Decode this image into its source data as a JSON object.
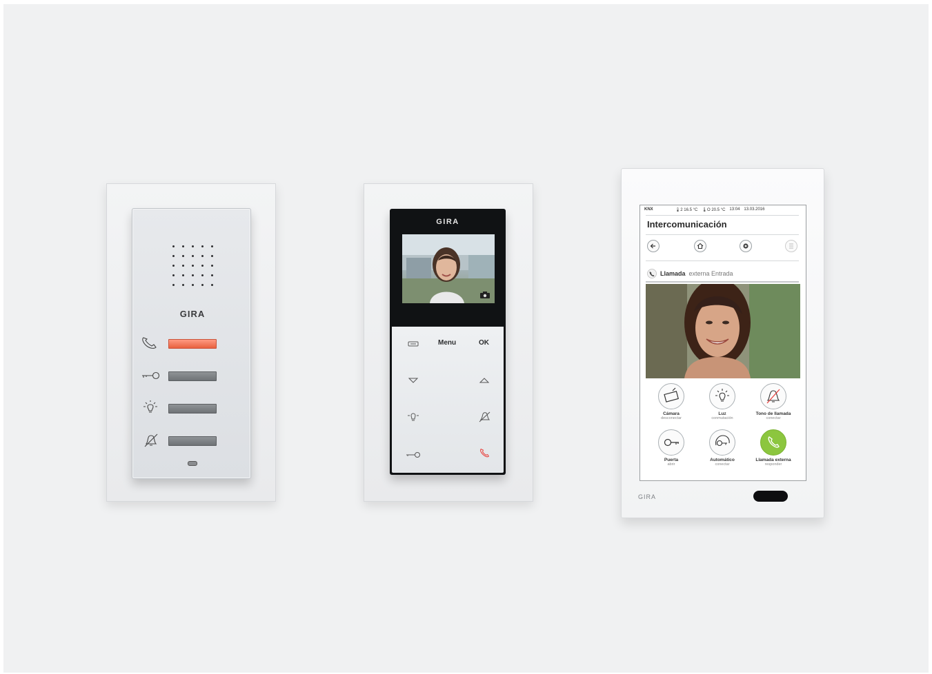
{
  "devices": {
    "audio_station": {
      "brand": "GIRA",
      "rows": [
        {
          "icon": "handset-icon",
          "state": "lit"
        },
        {
          "icon": "key-icon",
          "state": "off"
        },
        {
          "icon": "light-icon",
          "state": "off"
        },
        {
          "icon": "bell-mute-icon",
          "state": "off"
        }
      ]
    },
    "video_station": {
      "brand": "GIRA",
      "keys": {
        "menu": "Menu",
        "ok": "OK"
      },
      "colors": {
        "hangup": "#e8403c"
      }
    },
    "touch_panel": {
      "brand": "GIRA",
      "status": {
        "system": "KNX",
        "temp1": "🌡2 16.5 °C",
        "temp2": "🌡O 20.5 °C",
        "time": "13:04",
        "date": "13.03.2016"
      },
      "title": "Intercomunicación",
      "call": {
        "bold": "Llamada",
        "rest": "externa Entrada"
      },
      "buttons": [
        {
          "label": "Cámara",
          "sub": "desconectar",
          "icon": "camera-icon"
        },
        {
          "label": "Luz",
          "sub": "conmutación",
          "icon": "light-icon"
        },
        {
          "label": "Tono de llamada",
          "sub": "conectar",
          "icon": "bell-mute-icon"
        },
        {
          "label": "Puerta",
          "sub": "abrir",
          "icon": "key-icon"
        },
        {
          "label": "Automático",
          "sub": "conectar",
          "icon": "auto-door-icon"
        },
        {
          "label": "Llamada externa",
          "sub": "responder",
          "icon": "handset-icon"
        }
      ],
      "colors": {
        "accept": "#8cc63f"
      }
    }
  }
}
